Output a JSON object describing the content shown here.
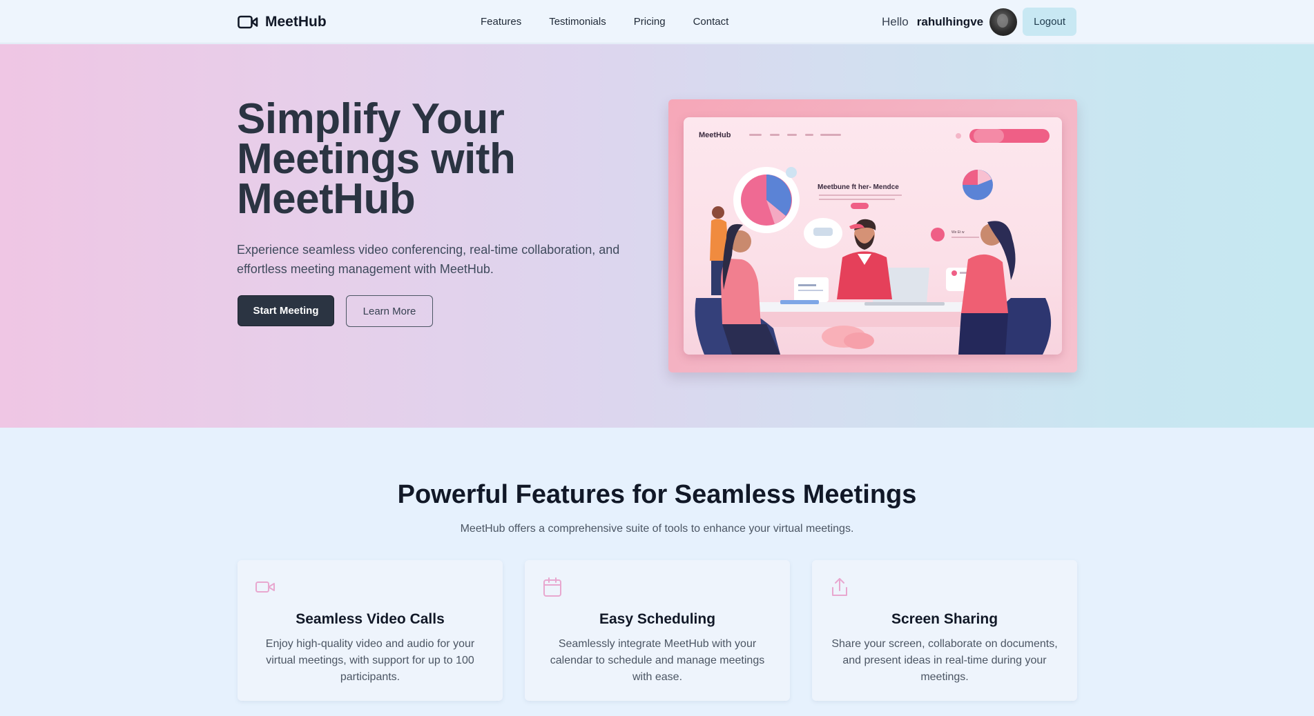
{
  "brand": {
    "name": "MeetHub"
  },
  "nav": {
    "links": [
      "Features",
      "Testimonials",
      "Pricing",
      "Contact"
    ],
    "greeting": "Hello",
    "username": "rahulhingve",
    "logout_label": "Logout"
  },
  "hero": {
    "title": "Simplify Your Meetings with MeetHub",
    "subtitle": "Experience seamless video conferencing, real-time collaboration, and effortless meeting management with MeetHub.",
    "primary_button": "Start Meeting",
    "secondary_button": "Learn More",
    "illustration": {
      "logo_text": "MeetHub",
      "headline_text": "Meetbune ft her-  Mendce",
      "small_label": "We Et w"
    }
  },
  "features": {
    "title": "Powerful Features for Seamless Meetings",
    "subtitle": "MeetHub offers a comprehensive suite of tools to enhance your virtual meetings.",
    "cards": [
      {
        "icon": "video-icon",
        "title": "Seamless Video Calls",
        "text": "Enjoy high-quality video and audio for your virtual meetings, with support for up to 100 participants."
      },
      {
        "icon": "calendar-icon",
        "title": "Easy Scheduling",
        "text": "Seamlessly integrate MeetHub with your calendar to schedule and manage meetings with ease."
      },
      {
        "icon": "share-icon",
        "title": "Screen Sharing",
        "text": "Share your screen, collaborate on documents, and present ideas in real-time during your meetings."
      }
    ]
  },
  "colors": {
    "accent_dark": "#2b3442",
    "logout_bg": "#c8e8f3",
    "feature_icon": "#e8a7cf"
  }
}
